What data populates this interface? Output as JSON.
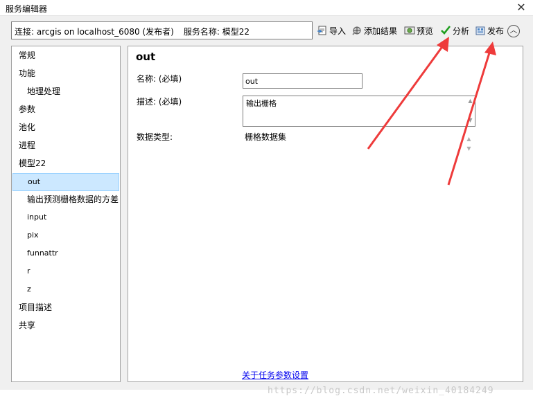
{
  "window": {
    "title": "服务编辑器",
    "close_label": "✕"
  },
  "connection": {
    "conn_text": "连接: arcgis on localhost_6080 (发布者)",
    "service_text": "服务名称: 模型22"
  },
  "toolbar": {
    "import_label": "导入",
    "add_result_label": "添加结果",
    "preview_label": "预览",
    "analyze_label": "分析",
    "publish_label": "发布",
    "collapse_label": "︿"
  },
  "sidebar": {
    "items": [
      {
        "label": "常规"
      },
      {
        "label": "功能"
      },
      {
        "label": "地理处理"
      },
      {
        "label": "参数"
      },
      {
        "label": "池化"
      },
      {
        "label": "进程"
      },
      {
        "label": "模型22"
      },
      {
        "label": "out"
      },
      {
        "label": "输出预测栅格数据的方差"
      },
      {
        "label": "input"
      },
      {
        "label": "pix"
      },
      {
        "label": "funnattr"
      },
      {
        "label": "r"
      },
      {
        "label": "z"
      },
      {
        "label": "项目描述"
      },
      {
        "label": "共享"
      }
    ]
  },
  "param": {
    "title": "out",
    "name_label": "名称: (必填)",
    "name_value": "out",
    "desc_label": "描述: (必填)",
    "desc_value": "输出栅格",
    "type_label": "数据类型:",
    "type_value": "栅格数据集",
    "help_link": "关于任务参数设置"
  },
  "watermark": "https://blog.csdn.net/weixin_40184249",
  "colors": {
    "selected_bg": "#cce8ff",
    "arrow": "#ee3b3b",
    "check": "#1e9e1e",
    "link": "#0000ee"
  }
}
